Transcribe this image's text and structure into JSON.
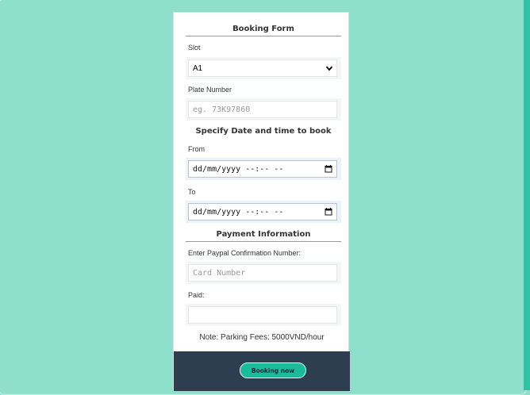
{
  "form": {
    "title": "Booking Form",
    "slot": {
      "label": "Slot",
      "selected": "A1"
    },
    "plate": {
      "label": "Plate Number",
      "placeholder": "eg. 73K97860"
    },
    "datetime": {
      "title": "Specify Date and time to book",
      "from_label": "From",
      "from_value": "dd/mm/yyyy --:-- --",
      "to_label": "To",
      "to_value": "dd/mm/yyyy --:-- --"
    },
    "payment": {
      "title": "Payment Information",
      "confirmation_label": "Enter Paypal Confirmation Number:",
      "confirmation_placeholder": "Card Number",
      "paid_label": "Paid:",
      "paid_value": ""
    },
    "note": "Note: Parking Fees: 5000VND/hour",
    "submit_label": "Booking now"
  },
  "colors": {
    "page_background": "#8edfcc",
    "accent": "#1abc9c",
    "footer": "#2c3e50",
    "right_strip": "#2fc3a4"
  },
  "icons": {
    "slot_dropdown": "chevron-down-icon",
    "from_picker": "calendar-icon",
    "to_picker": "calendar-icon"
  }
}
